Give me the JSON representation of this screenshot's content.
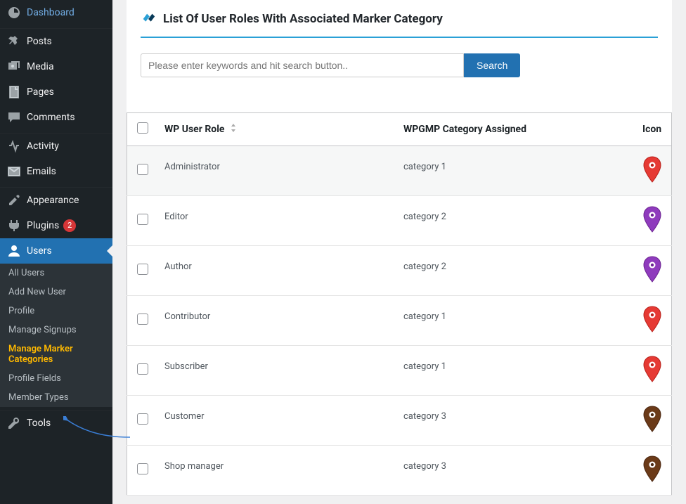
{
  "sidebar": {
    "items": [
      {
        "label": "Dashboard"
      },
      {
        "label": "Posts"
      },
      {
        "label": "Media"
      },
      {
        "label": "Pages"
      },
      {
        "label": "Comments"
      },
      {
        "label": "Activity"
      },
      {
        "label": "Emails"
      },
      {
        "label": "Appearance"
      },
      {
        "label": "Plugins",
        "badge": "2"
      },
      {
        "label": "Users"
      },
      {
        "label": "Tools"
      }
    ],
    "users_submenu": [
      {
        "label": "All Users"
      },
      {
        "label": "Add New User"
      },
      {
        "label": "Profile"
      },
      {
        "label": "Manage Signups"
      },
      {
        "label": "Manage Marker Categories",
        "current": true
      },
      {
        "label": "Profile Fields"
      },
      {
        "label": "Member Types"
      }
    ]
  },
  "panel": {
    "title": "List Of User Roles With Associated Marker Category"
  },
  "search": {
    "placeholder": "Please enter keywords and hit search button..",
    "button": "Search"
  },
  "table": {
    "headers": {
      "role": "WP User Role",
      "category": "WPGMP Category Assigned",
      "icon": "Icon"
    },
    "rows": [
      {
        "role": "Administrator",
        "category": "category 1",
        "icon": "red"
      },
      {
        "role": "Editor",
        "category": "category 2",
        "icon": "purple"
      },
      {
        "role": "Author",
        "category": "category 2",
        "icon": "purple"
      },
      {
        "role": "Contributor",
        "category": "category 1",
        "icon": "red"
      },
      {
        "role": "Subscriber",
        "category": "category 1",
        "icon": "red"
      },
      {
        "role": "Customer",
        "category": "category 3",
        "icon": "brown"
      },
      {
        "role": "Shop manager",
        "category": "category 3",
        "icon": "brown"
      }
    ]
  },
  "icon_colors": {
    "red": {
      "fill": "#e63a34",
      "stroke": "#b8201a"
    },
    "purple": {
      "fill": "#8f3bbd",
      "stroke": "#6b2291"
    },
    "brown": {
      "fill": "#6b3a18",
      "stroke": "#4a2610"
    }
  }
}
